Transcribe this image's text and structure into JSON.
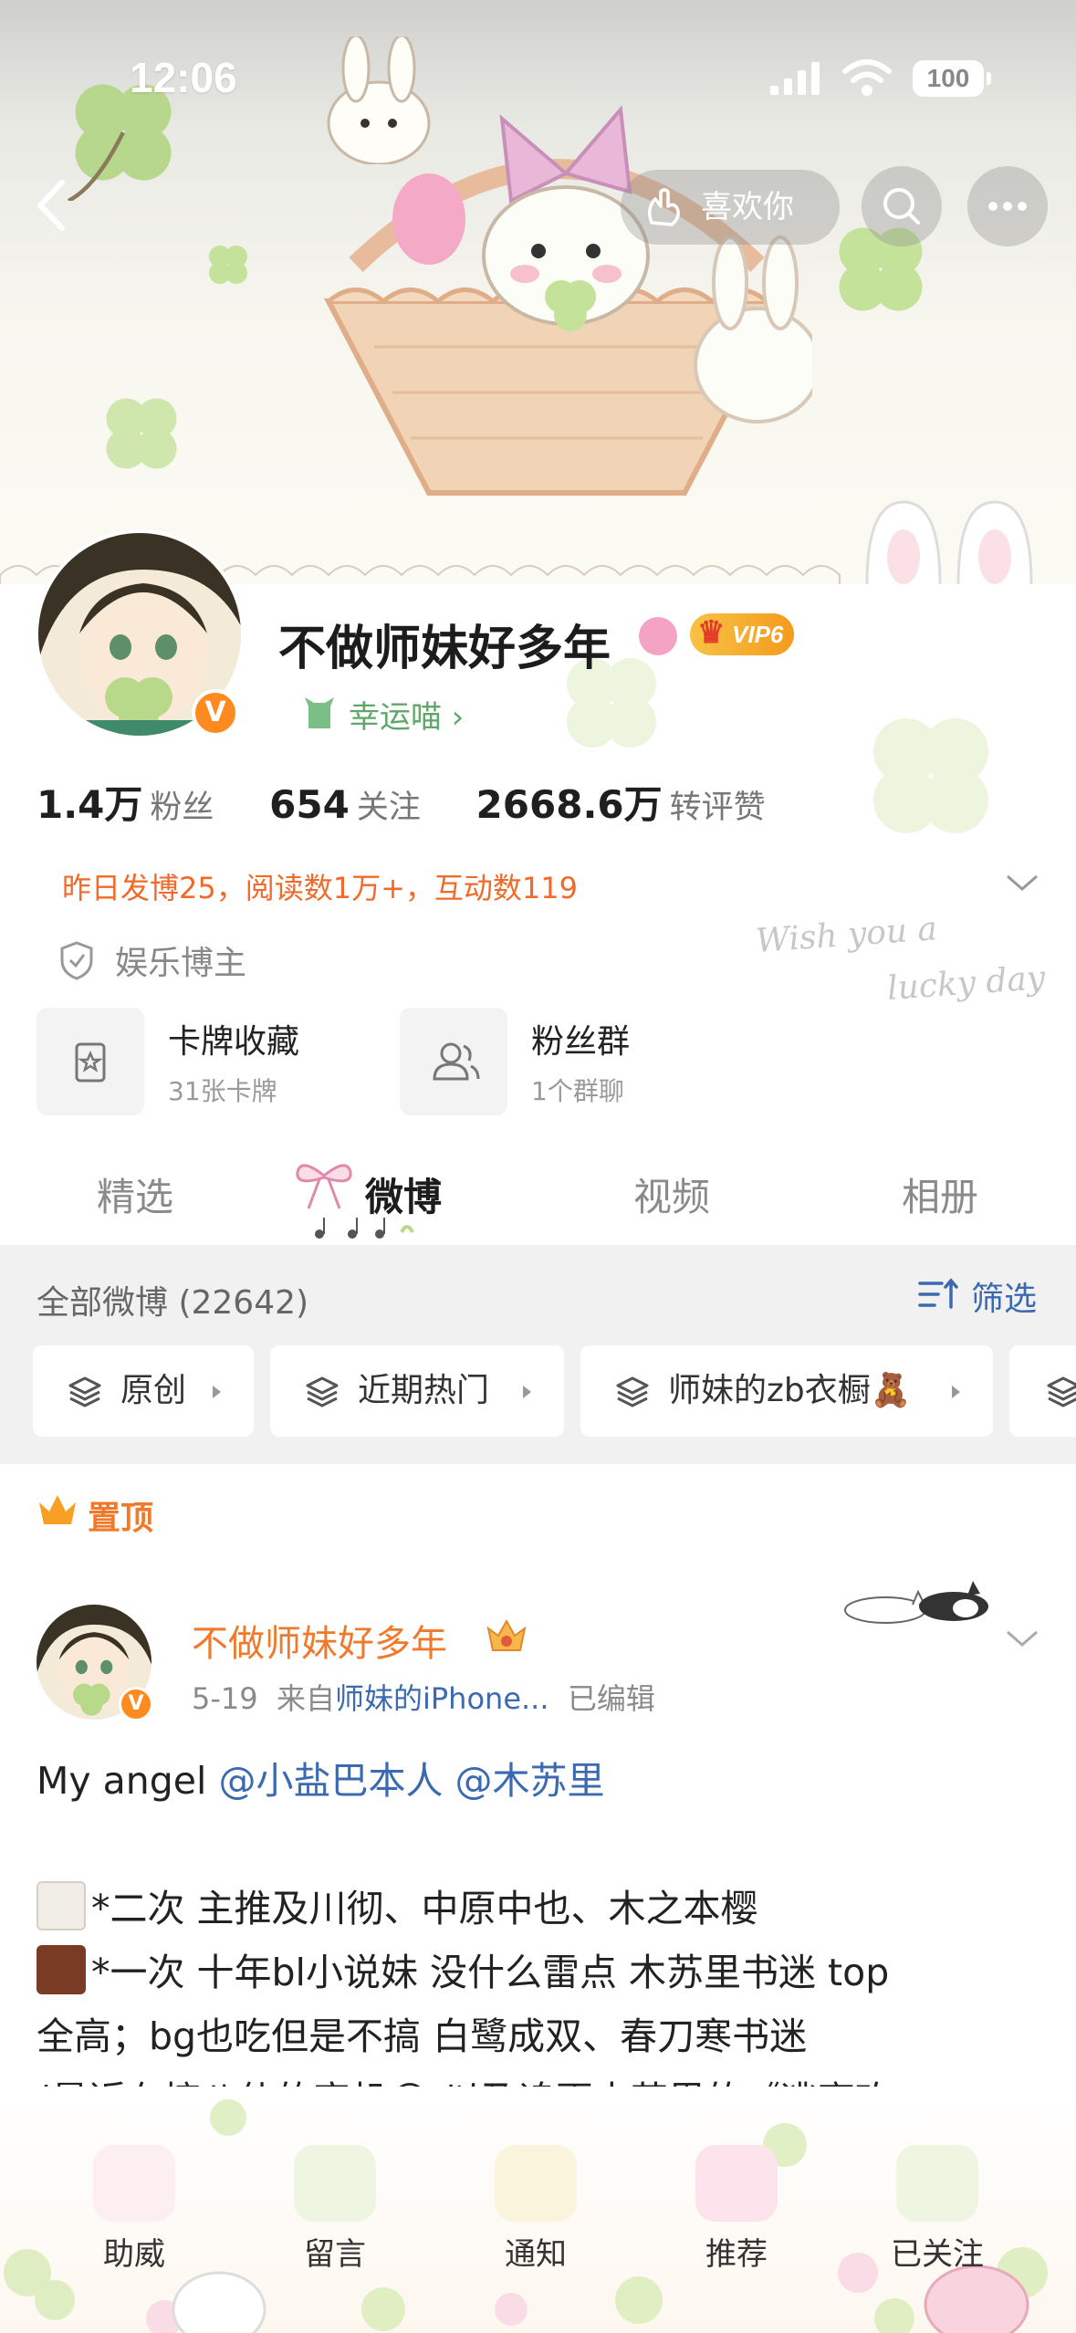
{
  "status_bar": {
    "time": "12:06",
    "battery": "100"
  },
  "header": {
    "like_label": "喜欢你"
  },
  "profile": {
    "nickname": "不做师妹好多年",
    "vip": "VIP6",
    "verified_mark": "V",
    "lucky_label": "幸运喵 ›",
    "stats": [
      {
        "value": "1.4万",
        "label": "粉丝"
      },
      {
        "value": "654",
        "label": "关注"
      },
      {
        "value": "2668.6万",
        "label": "转评赞"
      }
    ],
    "yesterday": "昨日发博25，阅读数1万+，互动数119",
    "role": "娱乐博主",
    "banner_text_line1": "Wish you a",
    "banner_text_line2": "lucky day",
    "cards": [
      {
        "title": "卡牌收藏",
        "subtitle": "31张卡牌",
        "icon": "card-collection-icon"
      },
      {
        "title": "粉丝群",
        "subtitle": "1个群聊",
        "icon": "fan-group-icon"
      }
    ]
  },
  "tabs": [
    "精选",
    "微博",
    "视频",
    "相册"
  ],
  "active_tab": "微博",
  "feed": {
    "all_count": "全部微博 (22642)",
    "filter_label": "筛选",
    "chips": [
      "原创",
      "近期热门",
      "师妹的zb衣橱🧸",
      ""
    ]
  },
  "post": {
    "pinned_label": "置顶",
    "author": "不做师妹好多年",
    "date": "5-19",
    "from_prefix": "来自",
    "source": "师妹的iPhone...",
    "edited": "已编辑",
    "line1_text": "My angel ",
    "mention1": "@小盐巴本人",
    "mention2": "@木苏里",
    "line2": "*二次 主推及川彻、中原中也、木之本樱",
    "line3": "*一次 十年bl小说妹 没什么雷点 木苏里书迷 top",
    "line4": "全高；bg也吃但是不搞 白鹭成双、春刀寒书迷",
    "line5": "(最近在搞八仙的官机😂 以及追更木苏里的《逃离玫"
  },
  "bottom_bar": [
    "助威",
    "留言",
    "通知",
    "推荐",
    "已关注"
  ],
  "colors": {
    "accent_orange": "#f07a2b",
    "link_blue": "#3c6ab0",
    "clover_green": "#b9d98a"
  }
}
